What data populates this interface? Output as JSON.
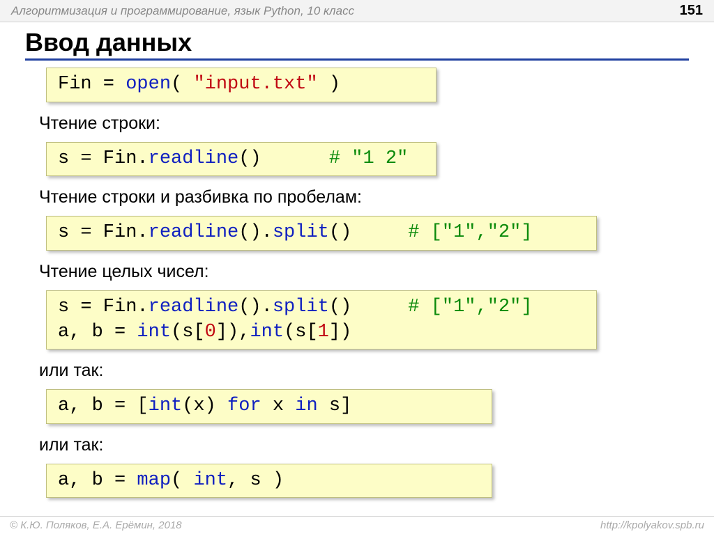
{
  "header": {
    "breadcrumb": "Алгоритмизация и программирование, язык Python, 10 класс",
    "page": "151"
  },
  "title": "Ввод данных",
  "blocks": [
    {
      "type": "code",
      "width": "cb-wide",
      "tokens": [
        {
          "t": "Fin = ",
          "c": ""
        },
        {
          "t": "open",
          "c": "kw-blue"
        },
        {
          "t": "( ",
          "c": ""
        },
        {
          "t": "\"input.txt\"",
          "c": "kw-red"
        },
        {
          "t": " )",
          "c": ""
        }
      ]
    },
    {
      "type": "label",
      "text": "Чтение строки:"
    },
    {
      "type": "code",
      "width": "cb-wide",
      "tokens": [
        {
          "t": "s = Fin.",
          "c": ""
        },
        {
          "t": "readline",
          "c": "kw-blue"
        },
        {
          "t": "()      ",
          "c": ""
        },
        {
          "t": "# \"1 2\"",
          "c": "kw-green"
        }
      ]
    },
    {
      "type": "label",
      "text": "Чтение строки и разбивка по пробелам:"
    },
    {
      "type": "code",
      "width": "cb-wider",
      "tokens": [
        {
          "t": "s = Fin.",
          "c": ""
        },
        {
          "t": "readline",
          "c": "kw-blue"
        },
        {
          "t": "().",
          "c": ""
        },
        {
          "t": "split",
          "c": "kw-blue"
        },
        {
          "t": "()     ",
          "c": ""
        },
        {
          "t": "# [\"1\",\"2\"]",
          "c": "kw-green"
        }
      ]
    },
    {
      "type": "label",
      "text": "Чтение целых чисел:"
    },
    {
      "type": "code",
      "width": "cb-wider",
      "tokens": [
        {
          "t": "s = Fin.",
          "c": ""
        },
        {
          "t": "readline",
          "c": "kw-blue"
        },
        {
          "t": "().",
          "c": ""
        },
        {
          "t": "split",
          "c": "kw-blue"
        },
        {
          "t": "()     ",
          "c": ""
        },
        {
          "t": "# [\"1\",\"2\"]",
          "c": "kw-green"
        },
        {
          "t": "\n",
          "c": ""
        },
        {
          "t": "a, b = ",
          "c": ""
        },
        {
          "t": "int",
          "c": "kw-blue"
        },
        {
          "t": "(s[",
          "c": ""
        },
        {
          "t": "0",
          "c": "kw-red"
        },
        {
          "t": "]),",
          "c": ""
        },
        {
          "t": "int",
          "c": "kw-blue"
        },
        {
          "t": "(s[",
          "c": ""
        },
        {
          "t": "1",
          "c": "kw-red"
        },
        {
          "t": "])",
          "c": ""
        }
      ]
    },
    {
      "type": "label",
      "text": "или так:"
    },
    {
      "type": "code",
      "width": "cb-mid",
      "tokens": [
        {
          "t": "a, b = [",
          "c": ""
        },
        {
          "t": "int",
          "c": "kw-blue"
        },
        {
          "t": "(x) ",
          "c": ""
        },
        {
          "t": "for",
          "c": "kw-blue"
        },
        {
          "t": " x ",
          "c": ""
        },
        {
          "t": "in",
          "c": "kw-blue"
        },
        {
          "t": " s]",
          "c": ""
        }
      ]
    },
    {
      "type": "label",
      "text": "или так:"
    },
    {
      "type": "code",
      "width": "cb-mid",
      "tokens": [
        {
          "t": "a, b = ",
          "c": ""
        },
        {
          "t": "map",
          "c": "kw-blue"
        },
        {
          "t": "( ",
          "c": ""
        },
        {
          "t": "int",
          "c": "kw-blue"
        },
        {
          "t": ", s )",
          "c": ""
        }
      ]
    }
  ],
  "footer": {
    "left": "© К.Ю. Поляков, Е.А. Ерёмин, 2018",
    "right": "http://kpolyakov.spb.ru"
  }
}
